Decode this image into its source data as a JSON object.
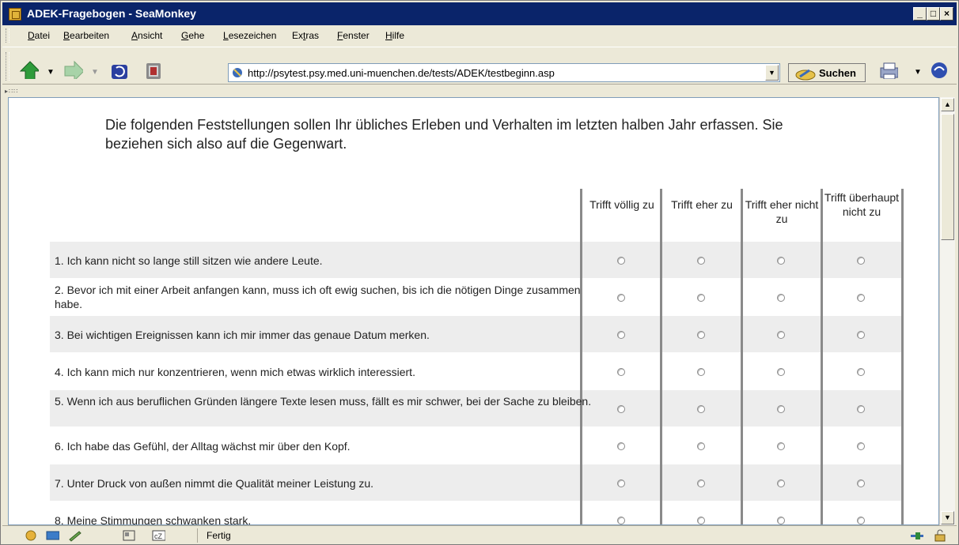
{
  "window": {
    "title": "ADEK-Fragebogen - SeaMonkey",
    "controls": {
      "minimize": "_",
      "maximize": "□",
      "close": "×"
    }
  },
  "menu": [
    "Datei",
    "Bearbeiten",
    "Ansicht",
    "Gehe",
    "Lesezeichen",
    "Extras",
    "Fenster",
    "Hilfe"
  ],
  "menu_underlines": [
    "D",
    "B",
    "A",
    "G",
    "L",
    "t",
    "F",
    "H"
  ],
  "toolbar": {
    "icons": [
      "back-icon",
      "forward-icon",
      "reload-icon",
      "stop-icon"
    ],
    "url": "http://psytest.psy.med.uni-muenchen.de/tests/ADEK/testbeginn.asp",
    "search_label": "Suchen",
    "right_icons": [
      "print-icon",
      "throbber-icon"
    ]
  },
  "content": {
    "intro": "Die folgenden Feststellungen sollen Ihr übliches Erleben und Verhalten im letzten halben Jahr erfassen. Sie beziehen sich also auf die Gegenwart.",
    "columns": [
      "Trifft völlig zu",
      "Trifft eher zu",
      "Trifft eher nicht zu",
      "Trifft überhaupt nicht zu"
    ],
    "questions": [
      "1. Ich kann nicht so lange still sitzen wie andere Leute.",
      "2. Bevor ich mit einer Arbeit anfangen kann, muss ich oft ewig suchen, bis ich die nötigen Dinge zusammen habe.",
      "3. Bei wichtigen Ereignissen kann ich mir immer das genaue Datum merken.",
      "4. Ich kann mich nur konzentrieren, wenn mich etwas wirklich interessiert.",
      "5. Wenn ich aus beruflichen Gründen längere Texte lesen muss, fällt es mir schwer, bei der Sache zu bleiben.",
      "6. Ich habe das Gefühl, der Alltag wächst mir über den Kopf.",
      "7. Unter Druck von außen nimmt die Qualität meiner Leistung zu.",
      "8. Meine Stimmungen schwanken stark."
    ]
  },
  "status": {
    "text": "Fertig"
  }
}
